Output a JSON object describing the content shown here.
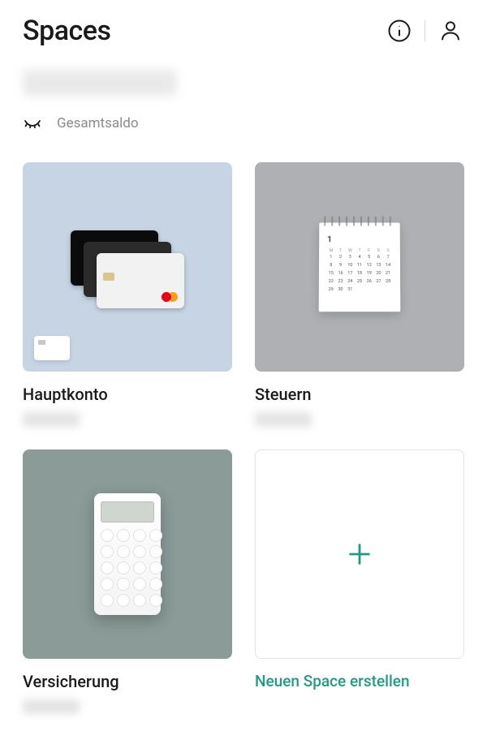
{
  "header": {
    "title": "Spaces"
  },
  "balance": {
    "label": "Gesamtsaldo"
  },
  "spaces": [
    {
      "name": "Hauptkonto",
      "tile_bg": "#c6d4e4",
      "icon": "cards"
    },
    {
      "name": "Steuern",
      "tile_bg": "#aeb0b3",
      "icon": "calendar"
    },
    {
      "name": "Versicherung",
      "tile_bg": "#8a9b98",
      "icon": "calculator"
    }
  ],
  "create": {
    "label": "Neuen Space erstellen"
  },
  "colors": {
    "accent": "#1f9d84"
  }
}
